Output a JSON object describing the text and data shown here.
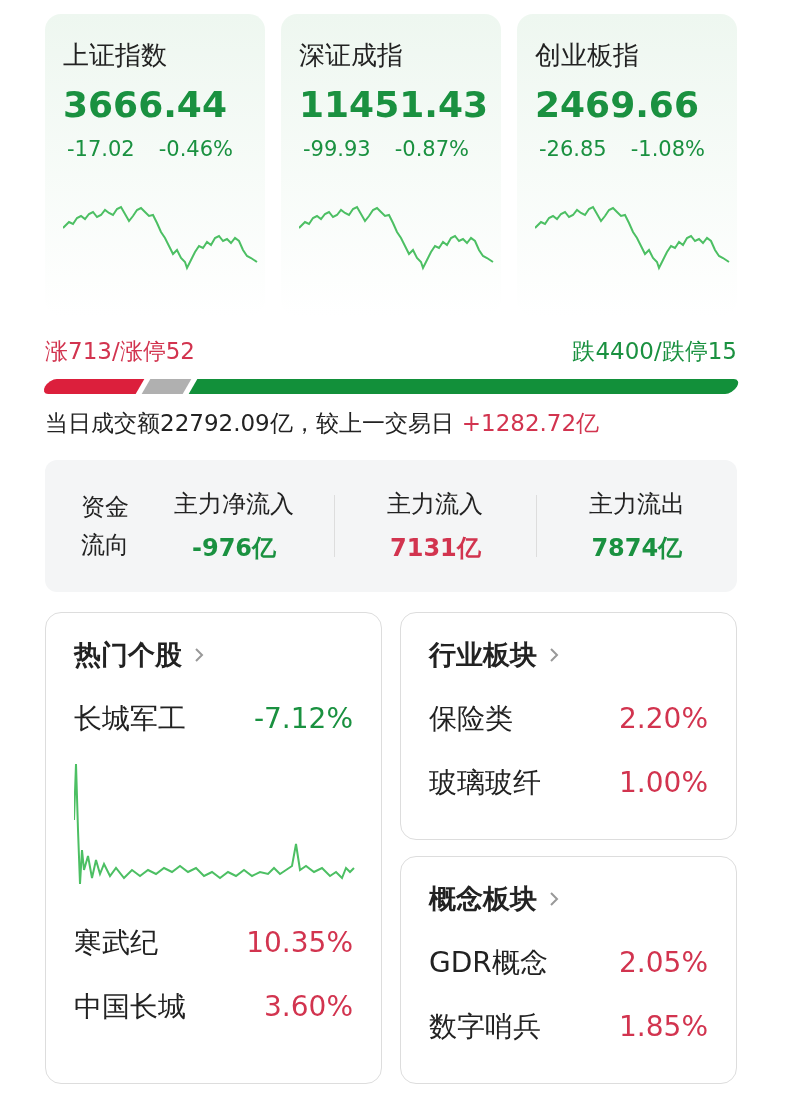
{
  "indices": [
    {
      "name": "上证指数",
      "value": "3666.44",
      "change": "-17.02",
      "percent": "-0.46%",
      "color": "#1a9140"
    },
    {
      "name": "深证成指",
      "value": "11451.43",
      "change": "-99.93",
      "percent": "-0.87%",
      "color": "#1a9140"
    },
    {
      "name": "创业板指",
      "value": "2469.66",
      "change": "-26.85",
      "percent": "-1.08%",
      "color": "#1a9140"
    }
  ],
  "breadth": {
    "up_label": "涨713/涨停52",
    "down_label": "跌4400/跌停15"
  },
  "turnover": {
    "text": "当日成交额22792.09亿，较上一交易日",
    "delta": "+1282.72亿",
    "color": "#d2344f"
  },
  "fund_flow": {
    "title": "资金流向",
    "items": [
      {
        "label": "主力净流入",
        "value": "-976亿",
        "color": "#1a9140"
      },
      {
        "label": "主力流入",
        "value": "7131亿",
        "color": "#d2344f"
      },
      {
        "label": "主力流出",
        "value": "7874亿",
        "color": "#1a9140"
      }
    ]
  },
  "hot_stocks": {
    "title": "热门个股",
    "featured": {
      "name": "长城军工",
      "percent": "-7.12%",
      "color": "#1a9140"
    },
    "rows": [
      {
        "name": "寒武纪",
        "percent": "10.35%",
        "color": "#d2344f"
      },
      {
        "name": "中国长城",
        "percent": "3.60%",
        "color": "#d2344f"
      }
    ]
  },
  "industry": {
    "title": "行业板块",
    "rows": [
      {
        "name": "保险类",
        "percent": "2.20%",
        "color": "#d2344f"
      },
      {
        "name": "玻璃玻纤",
        "percent": "1.00%",
        "color": "#d2344f"
      }
    ]
  },
  "concept": {
    "title": "概念板块",
    "rows": [
      {
        "name": "GDR概念",
        "percent": "2.05%",
        "color": "#d2344f"
      },
      {
        "name": "数字哨兵",
        "percent": "1.85%",
        "color": "#d2344f"
      }
    ]
  }
}
